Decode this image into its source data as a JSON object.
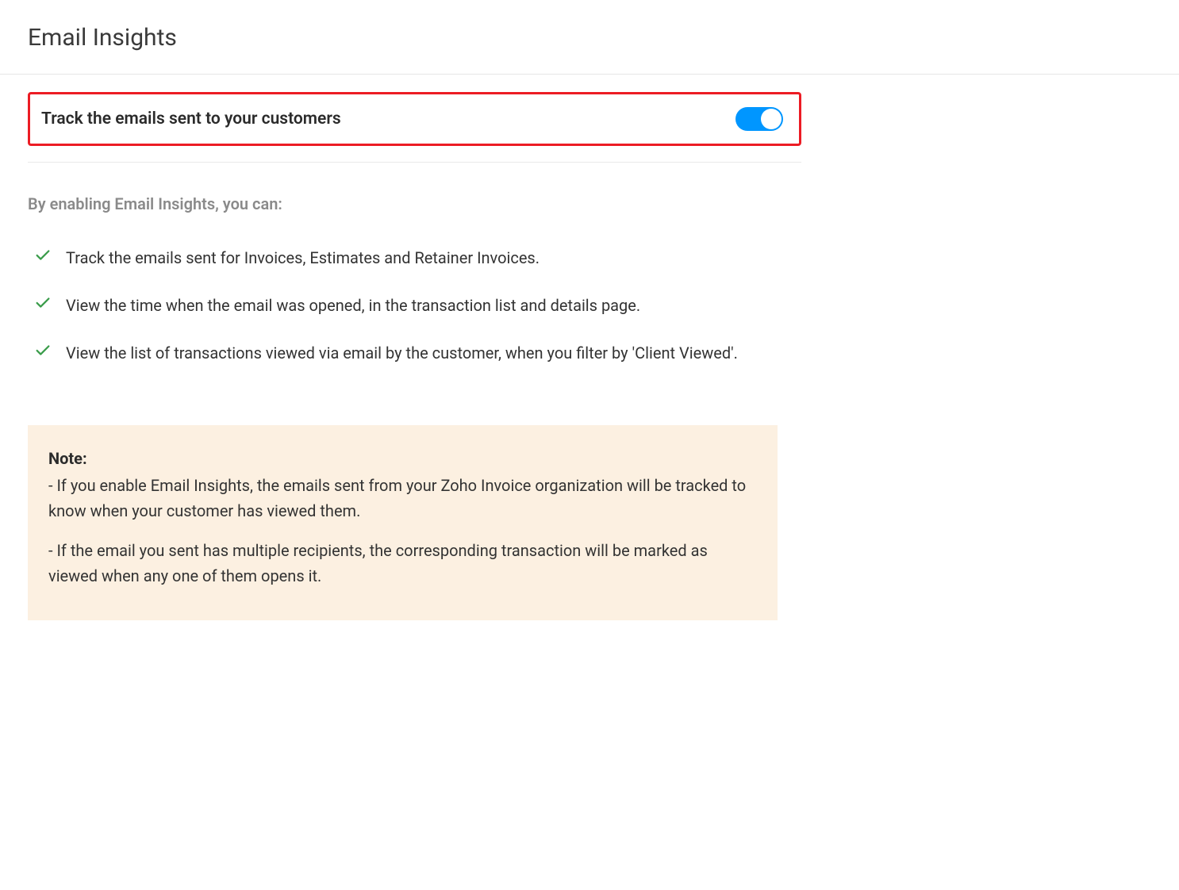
{
  "title": "Email Insights",
  "toggle": {
    "label": "Track the emails sent to your customers",
    "enabled": true
  },
  "subhead": "By enabling Email Insights, you can:",
  "features": [
    "Track the emails sent for Invoices, Estimates and Retainer Invoices.",
    "View the time when the email was opened, in the transaction list and details page.",
    "View the list of transactions viewed via email by the customer, when you filter by 'Client Viewed'."
  ],
  "note": {
    "title": "Note:",
    "items": [
      "-  If you enable Email Insights, the emails sent from your Zoho Invoice organization will be tracked to know when your customer has viewed them.",
      "-  If the email you sent has multiple recipients, the corresponding transaction will be marked as viewed when any one of them opens it."
    ]
  }
}
